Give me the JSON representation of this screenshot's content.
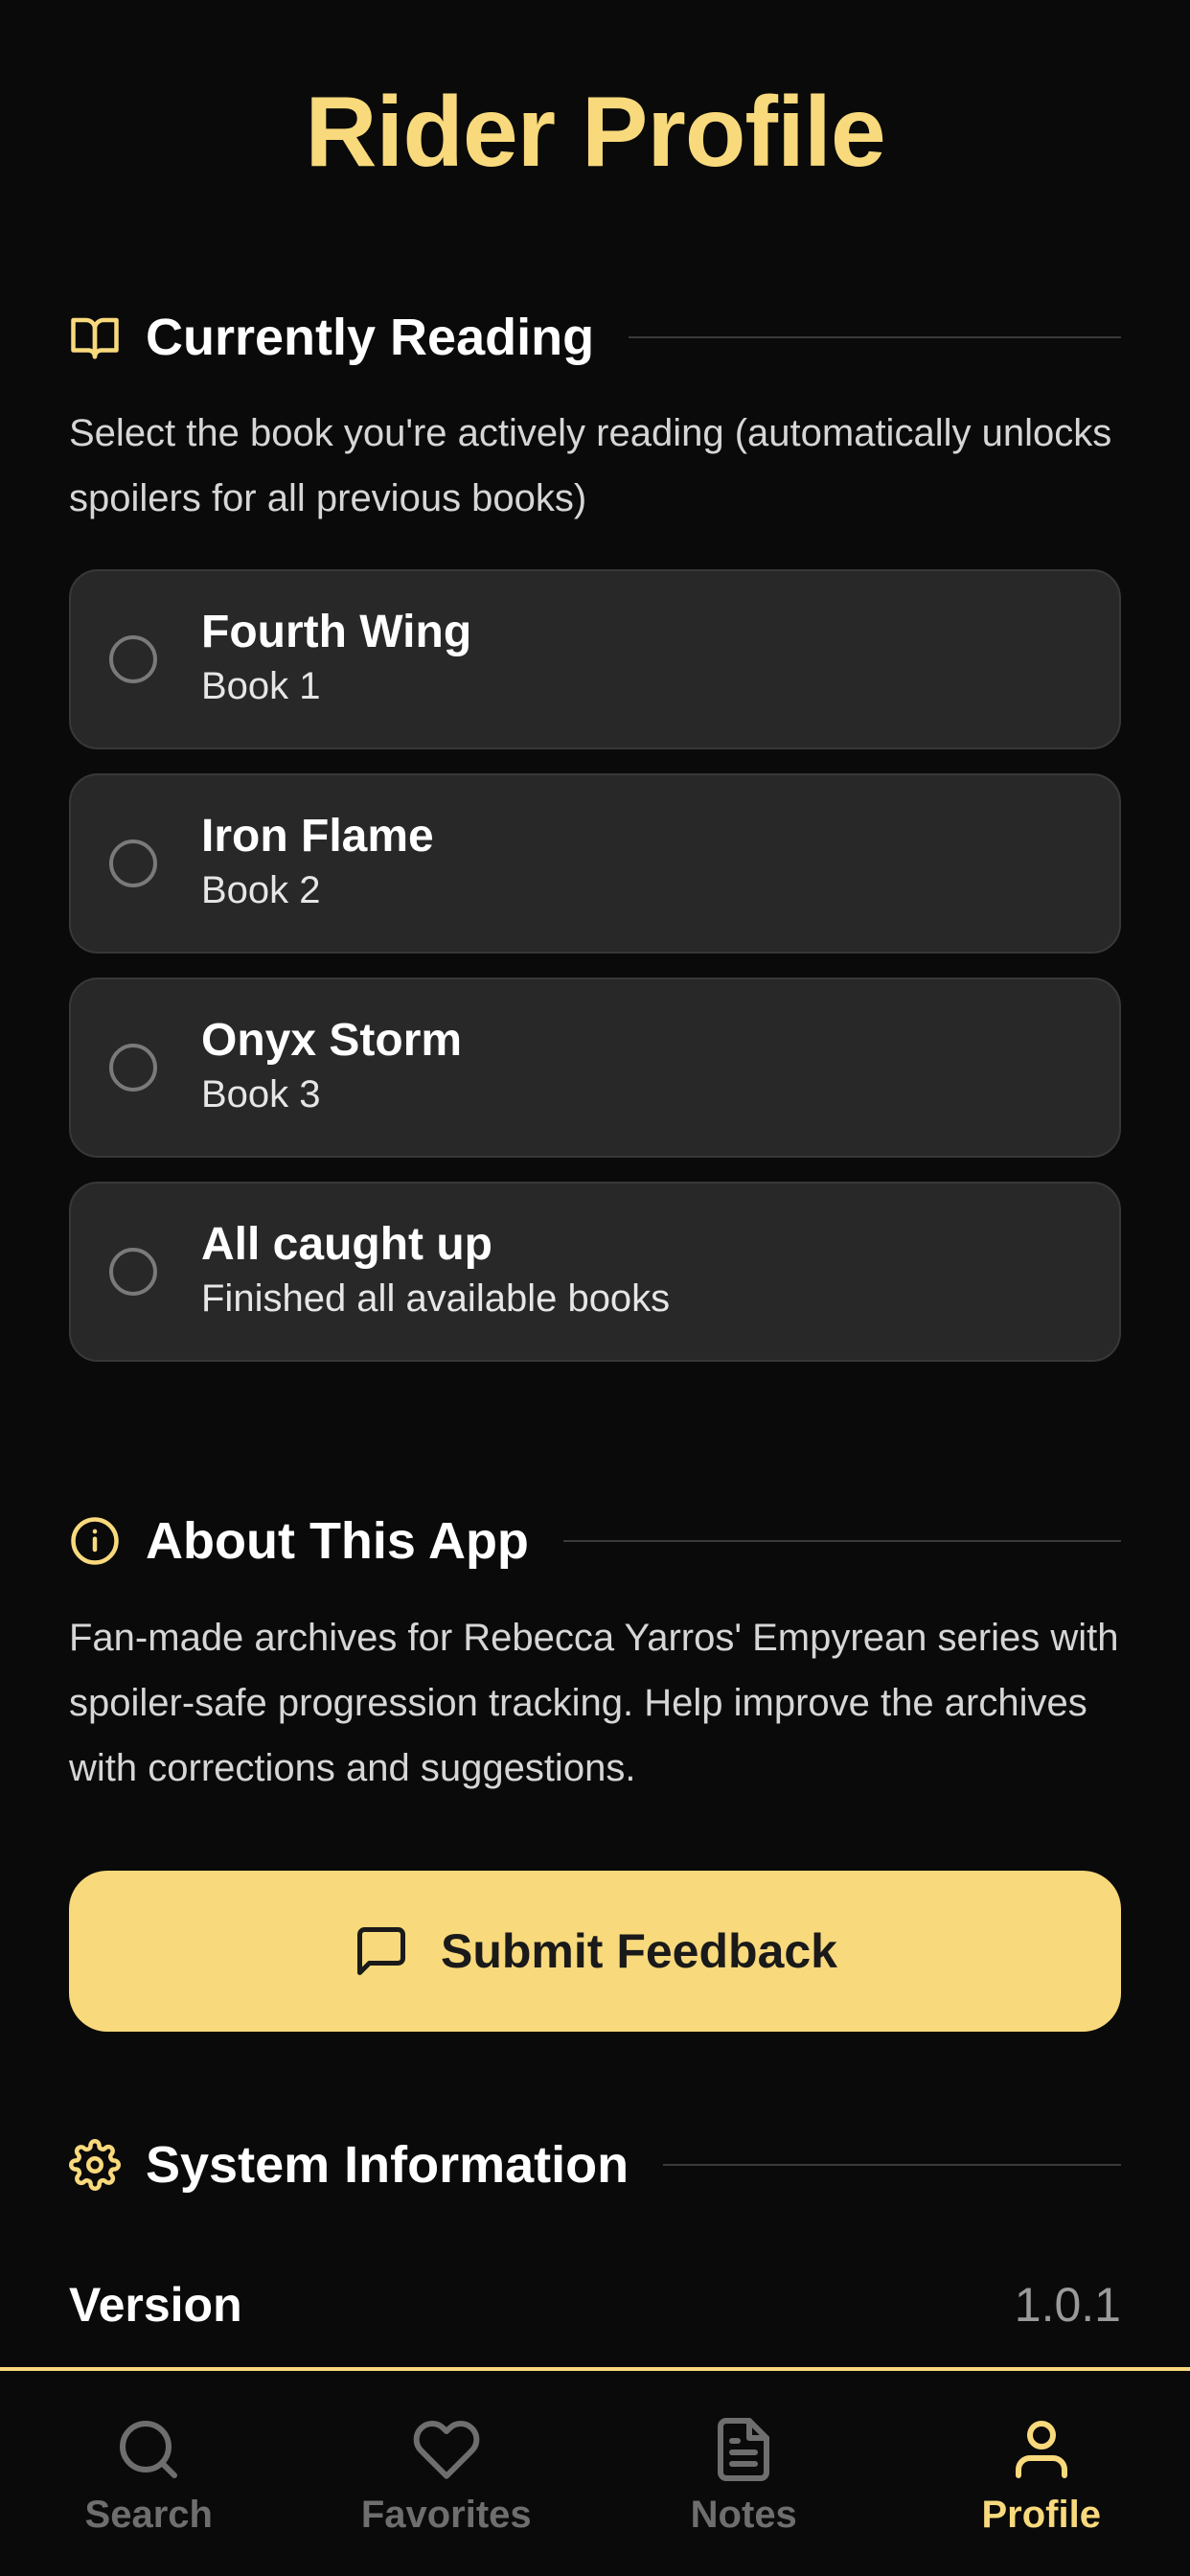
{
  "page": {
    "title": "Rider Profile"
  },
  "colors": {
    "accent": "#f8d97c",
    "background": "#0a0a0a",
    "card": "#282828",
    "muted": "#6e6e6e"
  },
  "currently_reading": {
    "icon": "book-open-icon",
    "title": "Currently Reading",
    "description": "Select the book you're actively reading (automatically unlocks spoilers for all previous books)",
    "options": [
      {
        "name": "Fourth Wing",
        "sub": "Book 1",
        "selected": false
      },
      {
        "name": "Iron Flame",
        "sub": "Book 2",
        "selected": false
      },
      {
        "name": "Onyx Storm",
        "sub": "Book 3",
        "selected": false
      },
      {
        "name": "All caught up",
        "sub": "Finished all available books",
        "selected": false
      }
    ]
  },
  "about": {
    "icon": "info-icon",
    "title": "About This App",
    "description": "Fan-made archives for Rebecca Yarros' Empyrean series with spoiler-safe progression tracking. Help improve the archives with corrections and suggestions.",
    "feedback_button": {
      "icon": "message-square-icon",
      "label": "Submit Feedback"
    }
  },
  "system": {
    "icon": "gear-icon",
    "title": "System Information",
    "rows": [
      {
        "key": "Version",
        "value": "1.0.1"
      }
    ]
  },
  "tabs": [
    {
      "label": "Search",
      "icon": "search-icon",
      "active": false
    },
    {
      "label": "Favorites",
      "icon": "heart-icon",
      "active": false
    },
    {
      "label": "Notes",
      "icon": "document-icon",
      "active": false
    },
    {
      "label": "Profile",
      "icon": "user-icon",
      "active": true
    }
  ]
}
